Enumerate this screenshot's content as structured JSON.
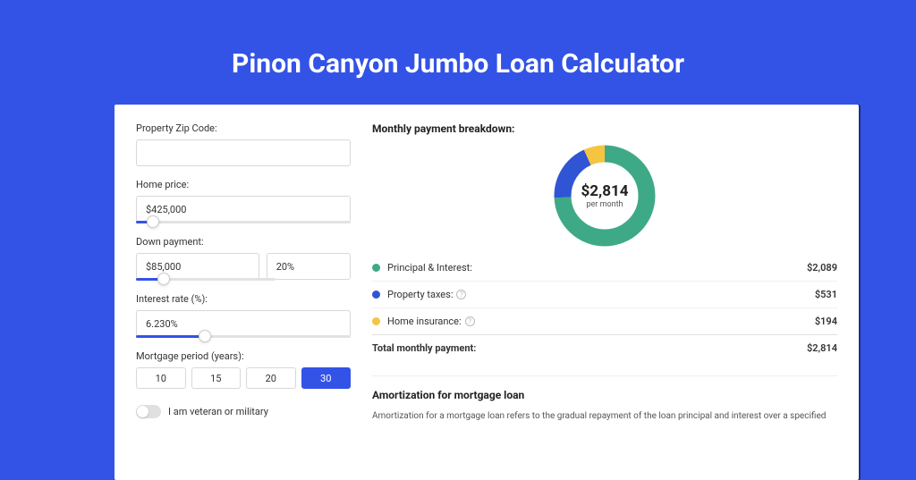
{
  "title": "Pinon Canyon Jumbo Loan Calculator",
  "left": {
    "zip_label": "Property Zip Code:",
    "zip_value": "",
    "home_price_label": "Home price:",
    "home_price_value": "$425,000",
    "home_price_slider_pct": 8,
    "down_payment_label": "Down payment:",
    "down_payment_value": "$85,000",
    "down_payment_pct_value": "20%",
    "down_payment_slider_pct": 20,
    "rate_label": "Interest rate (%):",
    "rate_value": "6.230%",
    "rate_slider_pct": 32,
    "period_label": "Mortgage period (years):",
    "periods": [
      "10",
      "15",
      "20",
      "30"
    ],
    "period_active_index": 3,
    "veteran_label": "I am veteran or military"
  },
  "right": {
    "breakdown_title": "Monthly payment breakdown:",
    "center_amount": "$2,814",
    "center_sub": "per month",
    "legend": {
      "pi": {
        "label": "Principal & Interest:",
        "value": "$2,089",
        "color": "#3ea987"
      },
      "tax": {
        "label": "Property taxes:",
        "value": "$531",
        "color": "#2f55d4"
      },
      "ins": {
        "label": "Home insurance:",
        "value": "$194",
        "color": "#f5c542"
      }
    },
    "total_label": "Total monthly payment:",
    "total_value": "$2,814",
    "amort_title": "Amortization for mortgage loan",
    "amort_text": "Amortization for a mortgage loan refers to the gradual repayment of the loan principal and interest over a specified"
  },
  "chart_data": {
    "type": "pie",
    "title": "Monthly payment breakdown",
    "series": [
      {
        "name": "Principal & Interest",
        "value": 2089,
        "color": "#3ea987"
      },
      {
        "name": "Property taxes",
        "value": 531,
        "color": "#2f55d4"
      },
      {
        "name": "Home insurance",
        "value": 194,
        "color": "#f5c542"
      }
    ],
    "total": 2814,
    "unit": "USD per month"
  }
}
